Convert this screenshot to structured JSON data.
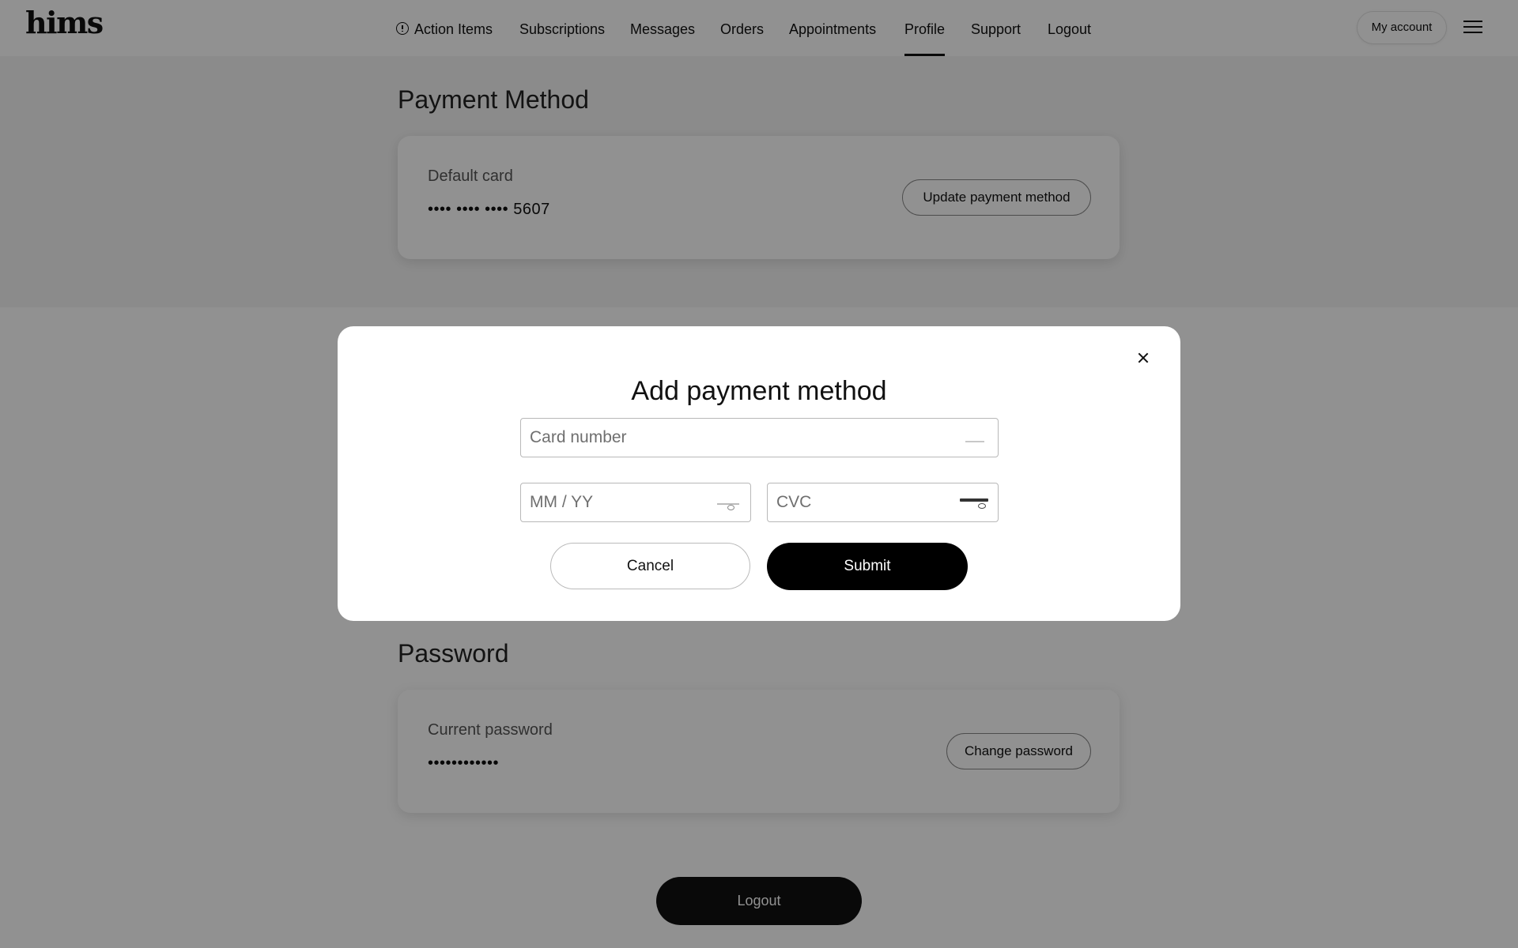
{
  "brand": {
    "logo_text": "hims"
  },
  "nav": {
    "items": [
      {
        "label": "Action Items",
        "icon": "alert-circle-icon",
        "active": false
      },
      {
        "label": "Subscriptions",
        "active": false
      },
      {
        "label": "Messages",
        "active": false
      },
      {
        "label": "Orders",
        "active": false
      },
      {
        "label": "Appointments",
        "active": false
      },
      {
        "label": "Profile",
        "active": true
      },
      {
        "label": "Support",
        "active": false
      },
      {
        "label": "Logout",
        "active": false
      }
    ],
    "account_label": "My account",
    "menu_icon": "hamburger-menu-icon"
  },
  "payment_section": {
    "title": "Payment Method",
    "card_label": "Default card",
    "card_value": "•••• •••• •••• 5607",
    "update_button": "Update payment method"
  },
  "password_section": {
    "title": "Password",
    "label": "Current password",
    "value": "••••••••••••",
    "change_button": "Change password"
  },
  "logout_button": "Logout",
  "modal": {
    "title": "Add payment method",
    "card_number_placeholder": "Card number",
    "expiry_placeholder": "MM / YY",
    "cvc_placeholder": "CVC",
    "cancel_label": "Cancel",
    "submit_label": "Submit",
    "close_icon": "close-icon"
  },
  "colors": {
    "overlay": "#000000",
    "primary_button": "#000000",
    "page_background": "#ffffff"
  }
}
